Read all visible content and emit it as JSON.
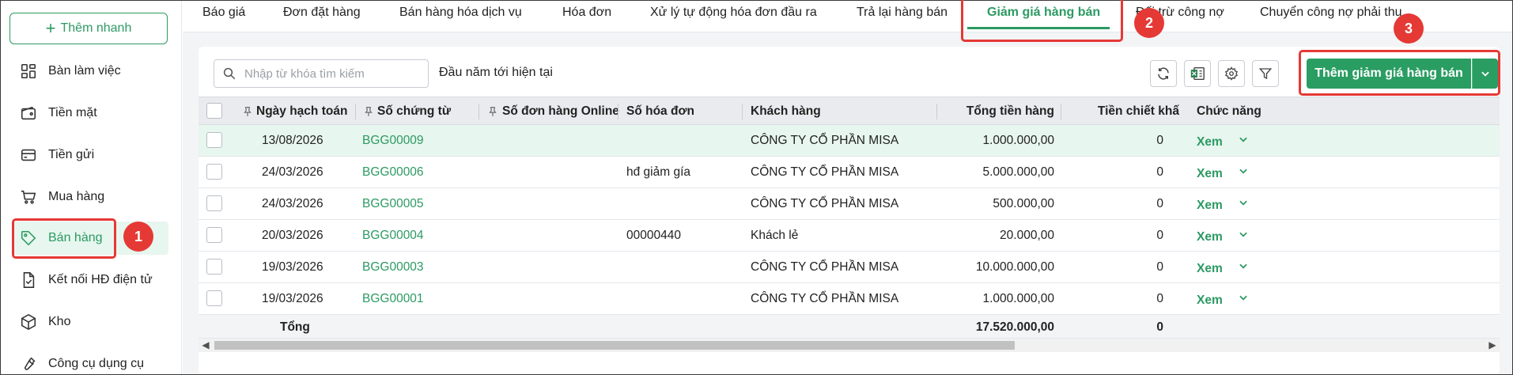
{
  "sidebar": {
    "quick_add_label": "Thêm nhanh",
    "items": [
      {
        "label": "Bàn làm việc",
        "icon": "dashboard-icon"
      },
      {
        "label": "Tiền mặt",
        "icon": "wallet-icon"
      },
      {
        "label": "Tiền gửi",
        "icon": "card-icon"
      },
      {
        "label": "Mua hàng",
        "icon": "cart-icon"
      },
      {
        "label": "Bán hàng",
        "icon": "tag-icon",
        "active": true
      },
      {
        "label": "Kết nối HĐ điện tử",
        "icon": "document-check-icon"
      },
      {
        "label": "Kho",
        "icon": "box-icon"
      },
      {
        "label": "Công cụ dụng cụ",
        "icon": "wrench-icon"
      }
    ]
  },
  "tabs": [
    {
      "label": "Báo giá"
    },
    {
      "label": "Đơn đặt hàng"
    },
    {
      "label": "Bán hàng hóa dịch vụ"
    },
    {
      "label": "Hóa đơn"
    },
    {
      "label": "Xử lý tự động hóa đơn đầu ra"
    },
    {
      "label": "Trả lại hàng bán"
    },
    {
      "label": "Giảm giá hàng bán",
      "active": true
    },
    {
      "label": "Đối trừ công nợ"
    },
    {
      "label": "Chuyển công nợ phải thu"
    }
  ],
  "toolbar": {
    "search_placeholder": "Nhập từ khóa tìm kiếm",
    "period": "Đầu năm tới hiện tại",
    "add_button": "Thêm giảm giá hàng bán"
  },
  "table": {
    "columns": [
      "Ngày hạch toán",
      "Số chứng từ",
      "Số đơn hàng Online",
      "Số hóa đơn",
      "Khách hàng",
      "Tổng tiền hàng",
      "Tiền chiết khấ",
      "Chức năng"
    ],
    "rows": [
      {
        "date": "13/08/2026",
        "doc": "BGG00009",
        "online": "",
        "invoice": "",
        "customer": "CÔNG TY CỔ PHẦN MISA",
        "total": "1.000.000,00",
        "discount": "0",
        "action": "Xem"
      },
      {
        "date": "24/03/2026",
        "doc": "BGG00006",
        "online": "",
        "invoice": "hđ giảm gía",
        "customer": "CÔNG TY CỔ PHẦN MISA",
        "total": "5.000.000,00",
        "discount": "0",
        "action": "Xem"
      },
      {
        "date": "24/03/2026",
        "doc": "BGG00005",
        "online": "",
        "invoice": "",
        "customer": "CÔNG TY CỔ PHẦN MISA",
        "total": "500.000,00",
        "discount": "0",
        "action": "Xem"
      },
      {
        "date": "20/03/2026",
        "doc": "BGG00004",
        "online": "",
        "invoice": "00000440",
        "customer": "Khách lẻ",
        "total": "20.000,00",
        "discount": "0",
        "action": "Xem"
      },
      {
        "date": "19/03/2026",
        "doc": "BGG00003",
        "online": "",
        "invoice": "",
        "customer": "CÔNG TY CỔ PHẦN MISA",
        "total": "10.000.000,00",
        "discount": "0",
        "action": "Xem"
      },
      {
        "date": "19/03/2026",
        "doc": "BGG00001",
        "online": "",
        "invoice": "",
        "customer": "CÔNG TY CỔ PHẦN MISA",
        "total": "1.000.000,00",
        "discount": "0",
        "action": "Xem"
      }
    ],
    "footer": {
      "label": "Tổng",
      "total": "17.520.000,00",
      "discount": "0"
    }
  },
  "annotations": [
    "1",
    "2",
    "3"
  ],
  "colors": {
    "accent": "#2c9a62",
    "highlight": "#e53935"
  }
}
